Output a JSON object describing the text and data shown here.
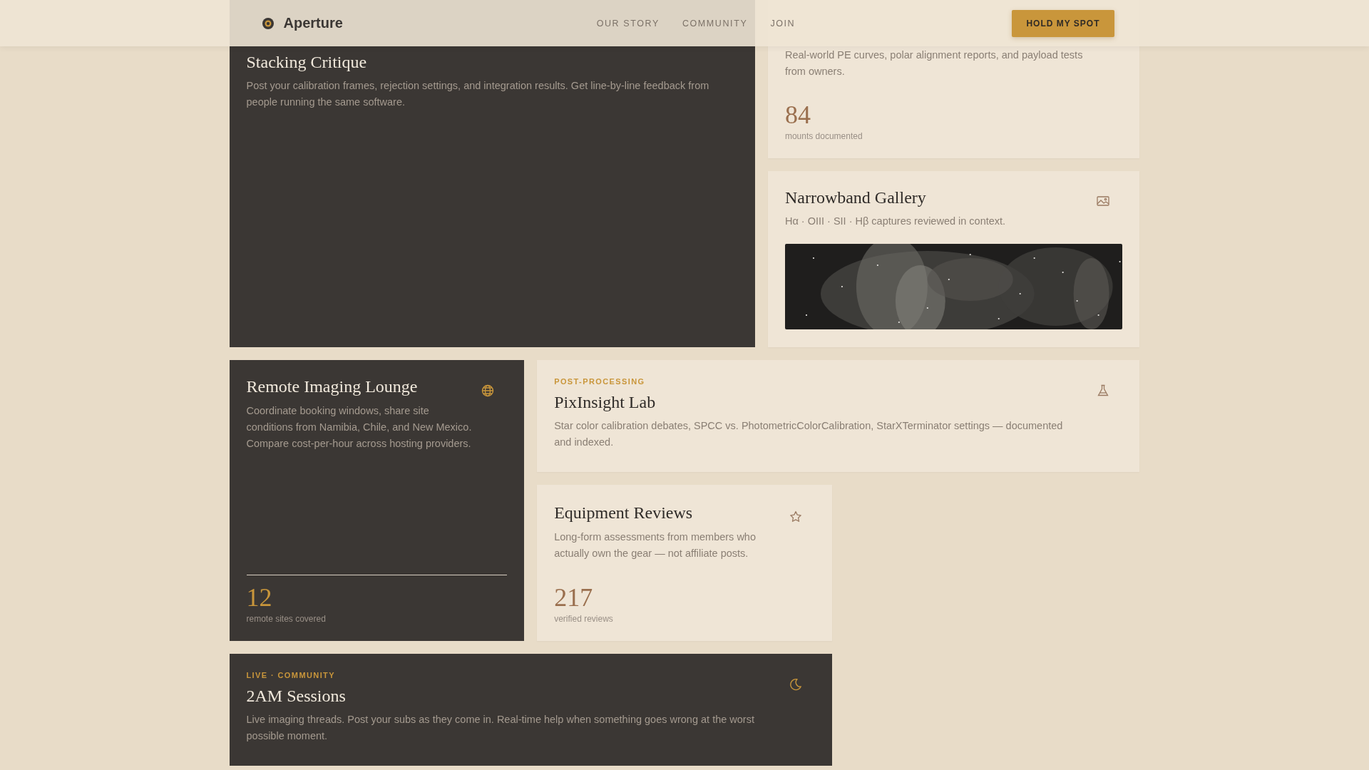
{
  "header": {
    "brand": "Aperture",
    "nav": [
      "OUR STORY",
      "COMMUNITY",
      "JOIN"
    ],
    "cta": "HOLD MY SPOT"
  },
  "cards": [
    {
      "kind": "dark",
      "title": "Stacking Critique",
      "description": "Post your calibration frames, rejection settings, and integration results. Get line-by-line feedback from people running the same software."
    },
    {
      "kind": "light",
      "description": "Real-world PE curves, polar alignment reports, and payload tests from owners.",
      "stat": {
        "value": "84",
        "label": "mounts documented"
      }
    },
    {
      "kind": "light",
      "title": "Narrowband Gallery",
      "description": "Hα · OIII · SII · Hβ captures reviewed in context."
    },
    {
      "kind": "dark",
      "title": "Remote Imaging Lounge",
      "description": "Coordinate booking windows, share site conditions from Namibia, Chile, and New Mexico. Compare cost-per-hour across hosting providers.",
      "stat": {
        "value": "12",
        "label": "remote sites covered"
      }
    },
    {
      "kind": "light",
      "eyebrow": "POST-PROCESSING",
      "title": "PixInsight Lab",
      "description": "Star color calibration debates, SPCC vs. PhotometricColorCalibration, StarXTerminator settings — documented and indexed."
    },
    {
      "kind": "light",
      "title": "Equipment Reviews",
      "description": "Long-form assessments from members who actually own the gear — not affiliate posts.",
      "stat": {
        "value": "217",
        "label": "verified reviews"
      }
    },
    {
      "kind": "dark",
      "eyebrow": "LIVE · COMMUNITY",
      "title": "2AM Sessions",
      "description": "Live imaging threads. Post your subs as they come in. Real-time help when something goes wrong at the worst possible moment."
    }
  ]
}
